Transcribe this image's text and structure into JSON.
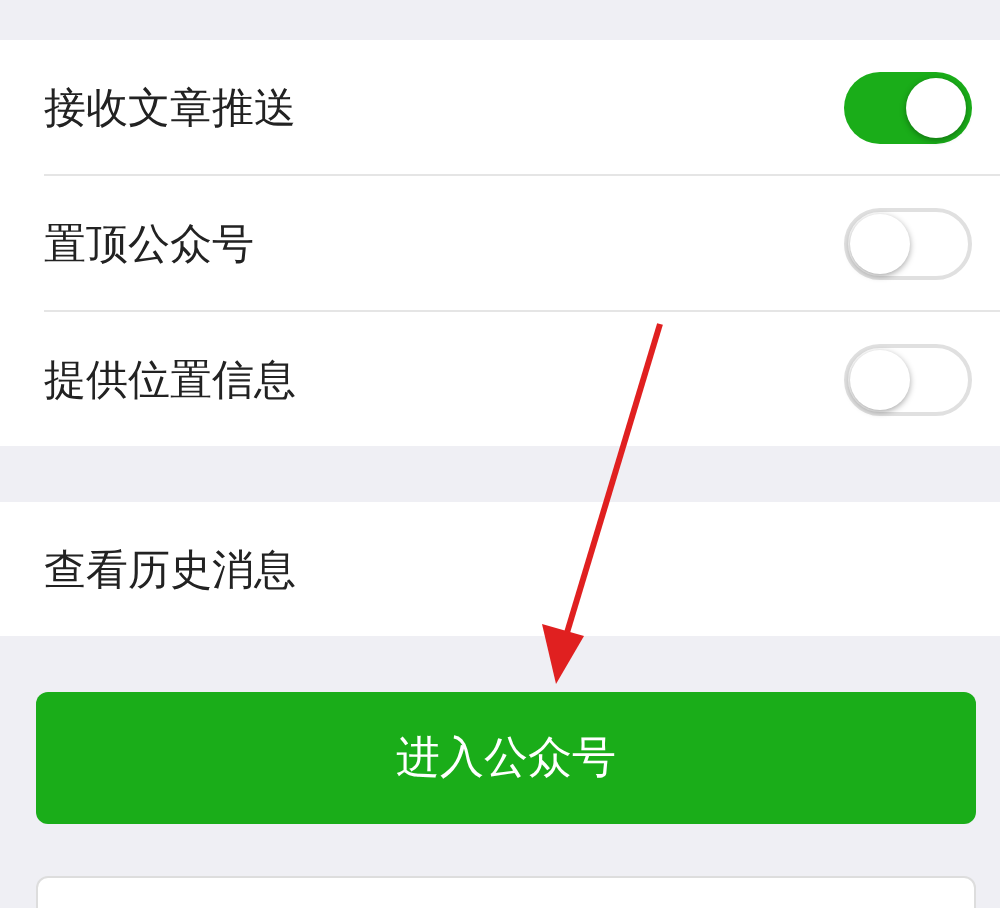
{
  "settings": [
    {
      "label": "接收文章推送",
      "on": true
    },
    {
      "label": "置顶公众号",
      "on": false
    },
    {
      "label": "提供位置信息",
      "on": false
    }
  ],
  "history": {
    "label": "查看历史消息"
  },
  "enter_button": {
    "label": "进入公众号"
  }
}
